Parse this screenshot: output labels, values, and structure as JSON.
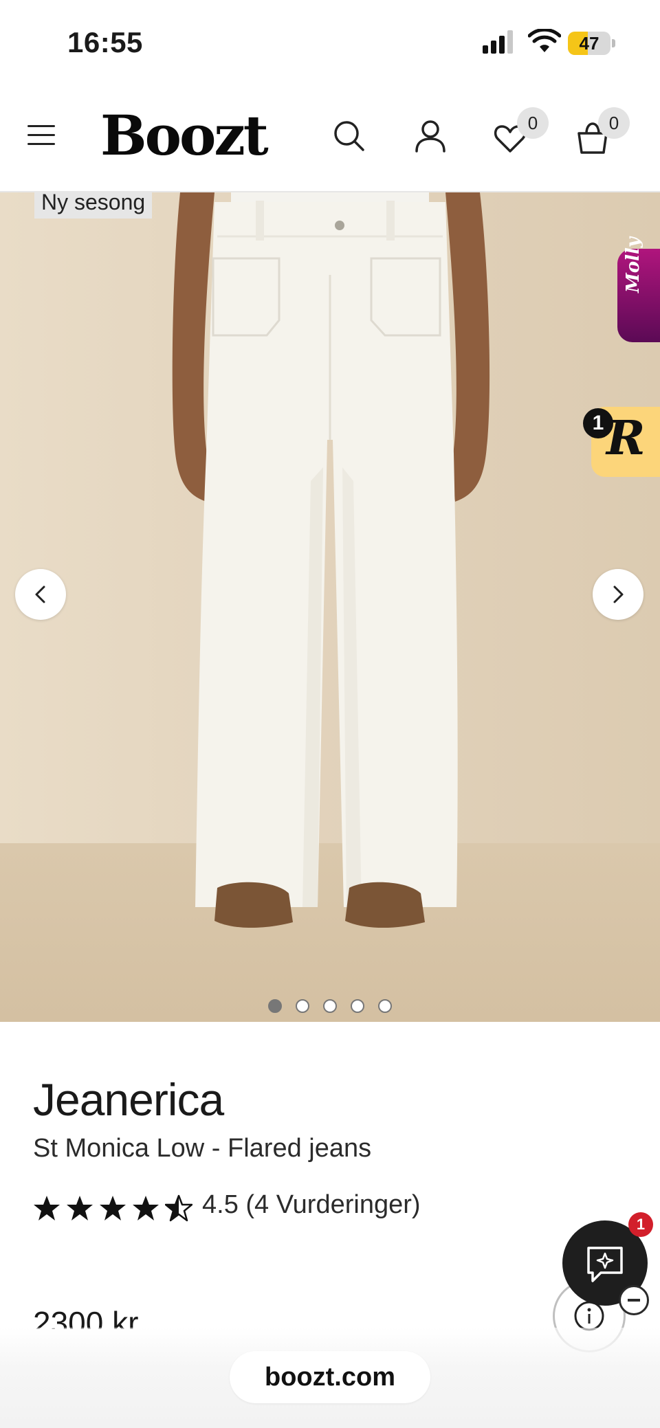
{
  "status_bar": {
    "time": "16:55",
    "battery_level": "47",
    "battery_fraction": 0.47
  },
  "header": {
    "logo_text": "Boozt",
    "wishlist_count": "0",
    "cart_count": "0",
    "icons": [
      "menu-icon",
      "search-icon",
      "user-icon",
      "heart-icon",
      "bag-icon"
    ]
  },
  "gallery": {
    "tag": "Ny sesong",
    "slide_count": 5,
    "active_slide": 1,
    "molly_label": "Molly",
    "r_widget_letter": "R",
    "r_widget_badge": "1"
  },
  "product": {
    "brand": "Jeanerica",
    "name": "St Monica Low - Flared jeans",
    "rating_value": 4.5,
    "rating_text": "4.5 (4 Vurderinger)",
    "price": "2300 kr"
  },
  "chat": {
    "badge": "1"
  },
  "browser": {
    "url": "boozt.com"
  },
  "colors": {
    "battery_fill": "#f5c518",
    "chat_badge": "#d21f2b",
    "molly_gradient": [
      "#b0157d",
      "#5b0a55"
    ],
    "r_widget": "#fcd57a"
  }
}
